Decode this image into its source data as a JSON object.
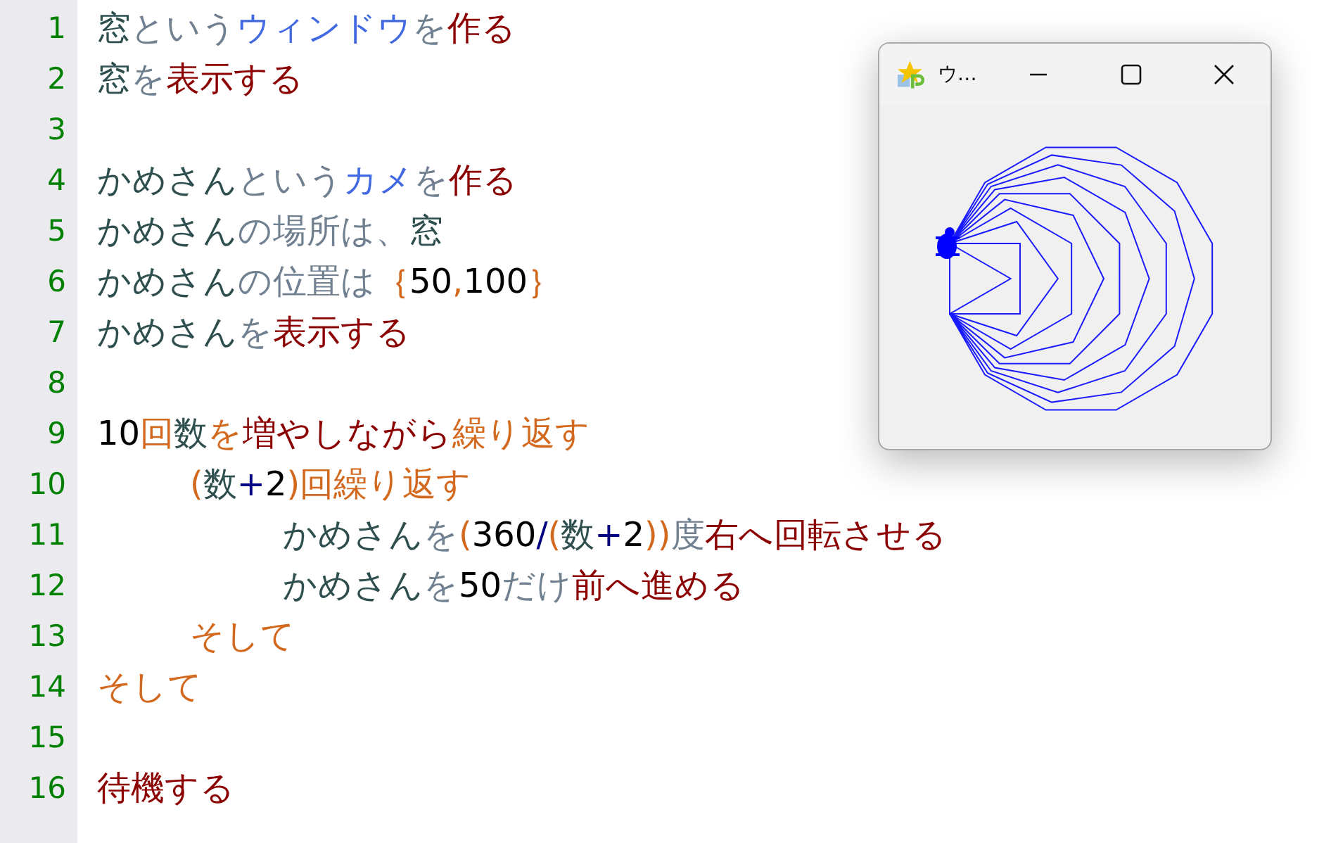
{
  "editor": {
    "lines": [
      {
        "number": "1",
        "tokens": [
          {
            "text": "窓",
            "kind": "name"
          },
          {
            "text": "という",
            "kind": "particle"
          },
          {
            "text": "ウィンドウ",
            "kind": "type"
          },
          {
            "text": "を",
            "kind": "particle"
          },
          {
            "text": "作る",
            "kind": "verb"
          }
        ]
      },
      {
        "number": "2",
        "tokens": [
          {
            "text": "窓",
            "kind": "name"
          },
          {
            "text": "を",
            "kind": "particle"
          },
          {
            "text": "表示する",
            "kind": "verb"
          }
        ]
      },
      {
        "number": "3"
      },
      {
        "number": "4",
        "tokens": [
          {
            "text": "かめさん",
            "kind": "name"
          },
          {
            "text": "という",
            "kind": "particle"
          },
          {
            "text": "カメ",
            "kind": "type"
          },
          {
            "text": "を",
            "kind": "particle"
          },
          {
            "text": "作る",
            "kind": "verb"
          }
        ]
      },
      {
        "number": "5",
        "tokens": [
          {
            "text": "かめさん",
            "kind": "name"
          },
          {
            "text": "の場所は、",
            "kind": "particle"
          },
          {
            "text": "窓",
            "kind": "name"
          }
        ]
      },
      {
        "number": "6",
        "tokens": [
          {
            "text": "かめさん",
            "kind": "name"
          },
          {
            "text": "の位置は",
            "kind": "particle"
          },
          {
            "text": "｛",
            "kind": "keyword"
          },
          {
            "text": "50",
            "kind": "number"
          },
          {
            "text": ",",
            "kind": "keyword"
          },
          {
            "text": "100",
            "kind": "number"
          },
          {
            "text": "｝",
            "kind": "keyword"
          }
        ]
      },
      {
        "number": "7",
        "tokens": [
          {
            "text": "かめさん",
            "kind": "name"
          },
          {
            "text": "を",
            "kind": "particle"
          },
          {
            "text": "表示する",
            "kind": "verb"
          }
        ]
      },
      {
        "number": "8"
      },
      {
        "number": "9",
        "tokens": [
          {
            "text": "10",
            "kind": "number"
          },
          {
            "text": "回",
            "kind": "keyword"
          },
          {
            "text": "数",
            "kind": "name"
          },
          {
            "text": "を",
            "kind": "keyword"
          },
          {
            "text": "増やしながら",
            "kind": "verb"
          },
          {
            "text": "繰り返す",
            "kind": "keyword"
          }
        ]
      },
      {
        "number": "10",
        "tokens": [
          {
            "text": "\t(",
            "kind": "keyword"
          },
          {
            "text": "数",
            "kind": "name"
          },
          {
            "text": "+",
            "kind": "operator"
          },
          {
            "text": "2",
            "kind": "number"
          },
          {
            "text": ")回繰り返す",
            "kind": "keyword"
          }
        ]
      },
      {
        "number": "11",
        "tokens": [
          {
            "text": "\t\tかめさん",
            "kind": "name"
          },
          {
            "text": "を",
            "kind": "particle"
          },
          {
            "text": "(",
            "kind": "keyword"
          },
          {
            "text": "360",
            "kind": "number"
          },
          {
            "text": "/",
            "kind": "operator"
          },
          {
            "text": "(",
            "kind": "keyword"
          },
          {
            "text": "数",
            "kind": "name"
          },
          {
            "text": "+",
            "kind": "operator"
          },
          {
            "text": "2",
            "kind": "number"
          },
          {
            "text": "))",
            "kind": "keyword"
          },
          {
            "text": "度",
            "kind": "particle"
          },
          {
            "text": "右へ回転させる",
            "kind": "verb"
          }
        ]
      },
      {
        "number": "12",
        "tokens": [
          {
            "text": "\t\tかめさん",
            "kind": "name"
          },
          {
            "text": "を",
            "kind": "particle"
          },
          {
            "text": "50",
            "kind": "number"
          },
          {
            "text": "だけ",
            "kind": "particle"
          },
          {
            "text": "前へ進める",
            "kind": "verb"
          }
        ]
      },
      {
        "number": "13",
        "tokens": [
          {
            "text": "\tそして",
            "kind": "keyword"
          }
        ]
      },
      {
        "number": "14",
        "tokens": [
          {
            "text": "そして",
            "kind": "keyword"
          }
        ]
      },
      {
        "number": "15"
      },
      {
        "number": "16",
        "tokens": [
          {
            "text": "待機する",
            "kind": "verb"
          }
        ]
      }
    ]
  },
  "window": {
    "title": "ウ…"
  }
}
